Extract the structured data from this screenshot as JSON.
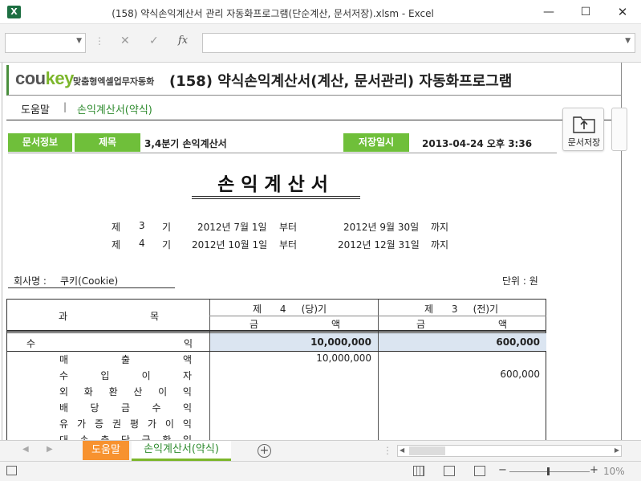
{
  "app": {
    "logo_text": "X",
    "title": "(158) 약식손익계산서 관리 자동화프로그램(단순계산, 문서저장).xlsm - Excel"
  },
  "window": {
    "minimize": "—",
    "maximize": "☐",
    "close": "✕"
  },
  "formula_bar": {
    "cancel": "✕",
    "enter": "✓",
    "fx": "fx",
    "dots": "⋮",
    "caret": "▼"
  },
  "brand": {
    "logo_main": "cou",
    "logo_accent": "key",
    "subtitle": "맞춤형엑셀업무자동화",
    "title": "(158) 약식손익계산서(계산, 문서관리) 자동화프로그램"
  },
  "nav": {
    "help": "도움말",
    "separator": "|",
    "current": "손익계산서(약식)"
  },
  "save_button": {
    "label": "문서저장",
    "icon": "upload-folder-icon"
  },
  "info": {
    "doc_info_label": "문서정보",
    "subject_label": "제목",
    "subject_value": "3,4분기 손익계산서",
    "saved_label": "저장일시",
    "saved_value": "2013-04-24  오후 3:36"
  },
  "report": {
    "title": "손익계산서",
    "period_current": {
      "prefix": "제",
      "number": "3",
      "suffix": "기",
      "start": "2012년 7월 1일",
      "from": "부터",
      "end": "2012년 9월 30일",
      "to": "까지"
    },
    "period_previous": {
      "prefix": "제",
      "number": "4",
      "suffix": "기",
      "start": "2012년 10월 1일",
      "from": "부터",
      "end": "2012년 12월 31일",
      "to": "까지"
    },
    "company_label": "회사명 :",
    "company_name": "쿠키(Cookie)",
    "unit": "단위 : 원"
  },
  "table": {
    "header_account_1": "과",
    "header_account_2": "목",
    "col_current": "제      4     (당)기",
    "col_previous": "제      3     (전)기",
    "amount_1": "금",
    "amount_2": "액",
    "revenue_label_1": "수",
    "revenue_label_2": "익",
    "revenue_current": "10,000,000",
    "revenue_previous": "600,000",
    "items": [
      {
        "chars": [
          "매",
          "출",
          "액"
        ],
        "current": "10,000,000",
        "previous": ""
      },
      {
        "chars": [
          "수",
          "입",
          "이",
          "자"
        ],
        "current": "",
        "previous": "600,000"
      },
      {
        "chars": [
          "외",
          "화",
          "환",
          "산",
          "이",
          "익"
        ],
        "current": "",
        "previous": ""
      },
      {
        "chars": [
          "배",
          "당",
          "금",
          "수",
          "익"
        ],
        "current": "",
        "previous": ""
      },
      {
        "chars": [
          "유",
          "가",
          "증",
          "권",
          "평",
          "가",
          "이",
          "익"
        ],
        "current": "",
        "previous": ""
      },
      {
        "chars": [
          "대",
          "손",
          "충",
          "당",
          "금",
          "환",
          "입"
        ],
        "current": "",
        "previous": ""
      }
    ]
  },
  "sheet_tabs": {
    "prev": "◀",
    "next": "▶",
    "help": "도움말",
    "main": "손익계산서(약식)",
    "add": "+",
    "dots": "⋮"
  },
  "status": {
    "zoom": "10%",
    "zoom_minus": "−",
    "zoom_plus": "+"
  }
}
